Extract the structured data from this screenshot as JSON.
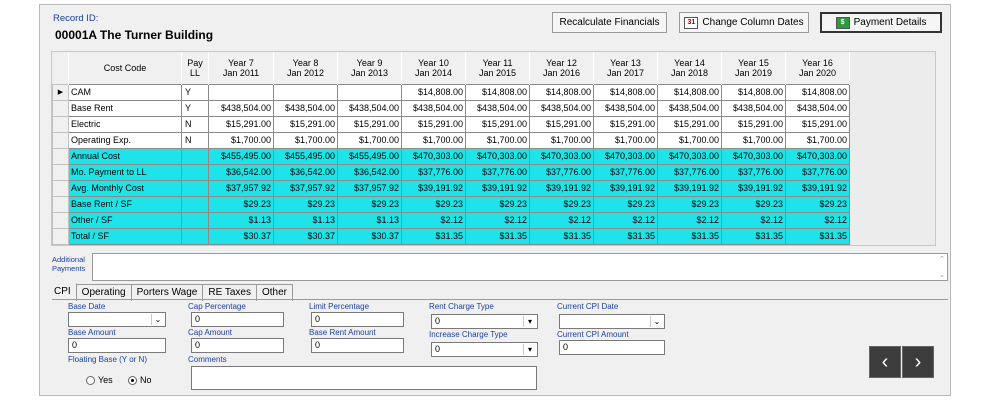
{
  "record": {
    "id_label": "Record ID:",
    "title": "00001A   The Turner Building"
  },
  "toolbar": {
    "recalculate": "Recalculate Financials",
    "change_dates": "Change Column Dates",
    "calendar_glyph": "31",
    "payment_details": "Payment Details",
    "money_glyph": "$"
  },
  "grid": {
    "headers": [
      {
        "line1": "Cost Code",
        "line2": ""
      },
      {
        "line1": "Pay",
        "line2": "LL"
      },
      {
        "line1": "Year 7",
        "line2": "Jan 2011"
      },
      {
        "line1": "Year 8",
        "line2": "Jan 2012"
      },
      {
        "line1": "Year 9",
        "line2": "Jan 2013"
      },
      {
        "line1": "Year 10",
        "line2": "Jan 2014"
      },
      {
        "line1": "Year 11",
        "line2": "Jan 2015"
      },
      {
        "line1": "Year 12",
        "line2": "Jan 2016"
      },
      {
        "line1": "Year 13",
        "line2": "Jan 2017"
      },
      {
        "line1": "Year 14",
        "line2": "Jan 2018"
      },
      {
        "line1": "Year 15",
        "line2": "Jan 2019"
      },
      {
        "line1": "Year 16",
        "line2": "Jan 2020"
      }
    ],
    "rows": [
      {
        "kind": "data",
        "current": true,
        "cells": [
          "CAM",
          "Y",
          "",
          "",
          "",
          "$14,808.00",
          "$14,808.00",
          "$14,808.00",
          "$14,808.00",
          "$14,808.00",
          "$14,808.00",
          "$14,808.00"
        ]
      },
      {
        "kind": "data",
        "current": false,
        "cells": [
          "Base Rent",
          "Y",
          "$438,504.00",
          "$438,504.00",
          "$438,504.00",
          "$438,504.00",
          "$438,504.00",
          "$438,504.00",
          "$438,504.00",
          "$438,504.00",
          "$438,504.00",
          "$438,504.00"
        ]
      },
      {
        "kind": "data",
        "current": false,
        "cells": [
          "Electric",
          "N",
          "$15,291.00",
          "$15,291.00",
          "$15,291.00",
          "$15,291.00",
          "$15,291.00",
          "$15,291.00",
          "$15,291.00",
          "$15,291.00",
          "$15,291.00",
          "$15,291.00"
        ]
      },
      {
        "kind": "data",
        "current": false,
        "cells": [
          "Operating Exp.",
          "N",
          "$1,700.00",
          "$1,700.00",
          "$1,700.00",
          "$1,700.00",
          "$1,700.00",
          "$1,700.00",
          "$1,700.00",
          "$1,700.00",
          "$1,700.00",
          "$1,700.00"
        ]
      },
      {
        "kind": "calc",
        "current": false,
        "cells": [
          "Annual Cost",
          "",
          "$455,495.00",
          "$455,495.00",
          "$455,495.00",
          "$470,303.00",
          "$470,303.00",
          "$470,303.00",
          "$470,303.00",
          "$470,303.00",
          "$470,303.00",
          "$470,303.00"
        ]
      },
      {
        "kind": "calc",
        "current": false,
        "cells": [
          "Mo. Payment to LL",
          "",
          "$36,542.00",
          "$36,542.00",
          "$36,542.00",
          "$37,776.00",
          "$37,776.00",
          "$37,776.00",
          "$37,776.00",
          "$37,776.00",
          "$37,776.00",
          "$37,776.00"
        ]
      },
      {
        "kind": "calc",
        "current": false,
        "cells": [
          "Avg. Monthly Cost",
          "",
          "$37,957.92",
          "$37,957.92",
          "$37,957.92",
          "$39,191.92",
          "$39,191.92",
          "$39,191.92",
          "$39,191.92",
          "$39,191.92",
          "$39,191.92",
          "$39,191.92"
        ]
      },
      {
        "kind": "calc",
        "current": false,
        "cells": [
          "Base Rent / SF",
          "",
          "$29.23",
          "$29.23",
          "$29.23",
          "$29.23",
          "$29.23",
          "$29.23",
          "$29.23",
          "$29.23",
          "$29.23",
          "$29.23"
        ]
      },
      {
        "kind": "calc",
        "current": false,
        "cells": [
          "Other / SF",
          "",
          "$1.13",
          "$1.13",
          "$1.13",
          "$2.12",
          "$2.12",
          "$2.12",
          "$2.12",
          "$2.12",
          "$2.12",
          "$2.12"
        ]
      },
      {
        "kind": "calc",
        "current": false,
        "cells": [
          "Total / SF",
          "",
          "$30.37",
          "$30.37",
          "$30.37",
          "$31.35",
          "$31.35",
          "$31.35",
          "$31.35",
          "$31.35",
          "$31.35",
          "$31.35"
        ]
      }
    ],
    "current_row_glyph": "▶",
    "calc_color": "#1fe3e8"
  },
  "additional_payments": {
    "label_line1": "Additional",
    "label_line2": "Payments",
    "value": ""
  },
  "tabs": [
    "CPI",
    "Operating",
    "Porters Wage",
    "RE Taxes",
    "Other"
  ],
  "cpi": {
    "base_date": {
      "label": "Base Date",
      "value": ""
    },
    "base_amount": {
      "label": "Base Amount",
      "value": "0"
    },
    "floating_base": {
      "label": "Floating Base (Y or N)",
      "yes": "Yes",
      "no": "No",
      "selected": "No"
    },
    "cap_percentage": {
      "label": "Cap Percentage",
      "value": "0"
    },
    "cap_amount": {
      "label": "Cap Amount",
      "value": "0"
    },
    "comments": {
      "label": "Comments",
      "value": ""
    },
    "limit_percentage": {
      "label": "Limit Percentage",
      "value": "0"
    },
    "base_rent_amount": {
      "label": "Base Rent Amount",
      "value": "0"
    },
    "rent_charge_type": {
      "label": "Rent Charge Type",
      "value": "0"
    },
    "increase_charge_type": {
      "label": "Increase Charge Type",
      "value": "0"
    },
    "current_cpi_date": {
      "label": "Current CPI Date",
      "value": ""
    },
    "current_cpi_amount": {
      "label": "Current CPI Amount",
      "value": "0"
    }
  },
  "nav": {
    "prev": "‹",
    "next": "›"
  }
}
